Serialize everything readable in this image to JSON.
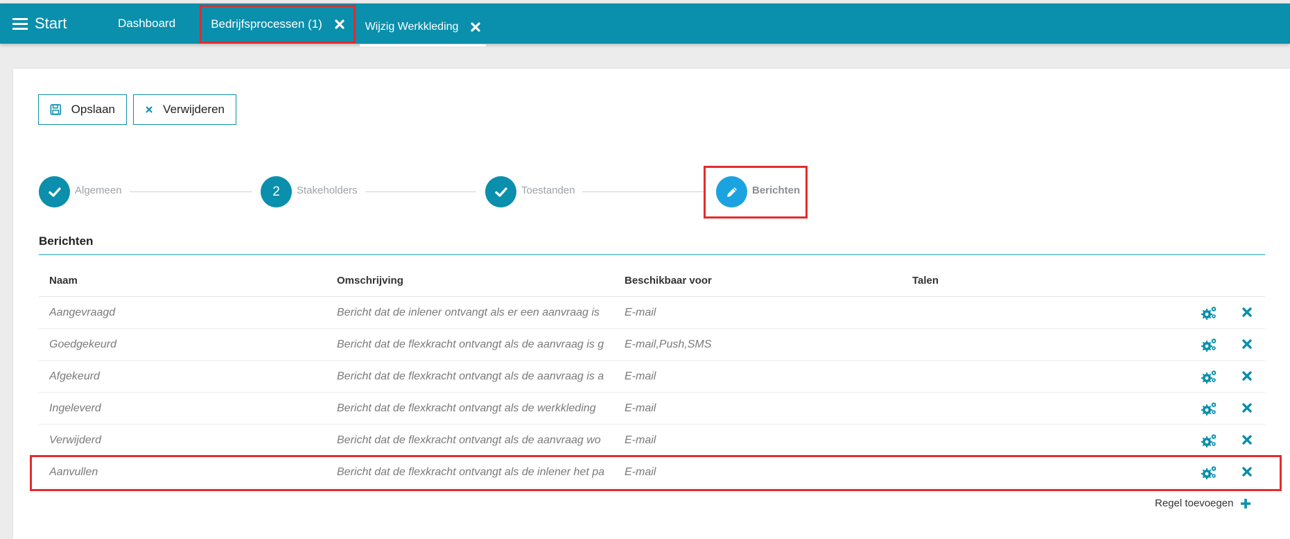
{
  "topbar": {
    "start_label": "Start",
    "tabs": [
      {
        "label": "Dashboard"
      },
      {
        "label": "Bedrijfsprocessen (1)"
      },
      {
        "label": "Wijzig Werkkleding"
      }
    ]
  },
  "toolbar": {
    "save_label": "Opslaan",
    "delete_label": "Verwijderen"
  },
  "steps": [
    {
      "label": "Algemeen",
      "state": "done"
    },
    {
      "label": "Stakeholders",
      "state": "numbered",
      "number": "2"
    },
    {
      "label": "Toestanden",
      "state": "done"
    },
    {
      "label": "Berichten",
      "state": "active"
    }
  ],
  "section": {
    "title": "Berichten"
  },
  "table": {
    "headers": [
      "Naam",
      "Omschrijving",
      "Beschikbaar voor",
      "Talen"
    ],
    "rows": [
      {
        "naam": "Aangevraagd",
        "omschrijving": "Bericht dat de inlener ontvangt als er een aanvraag is",
        "beschikbaar": "E-mail",
        "talen": ""
      },
      {
        "naam": "Goedgekeurd",
        "omschrijving": "Bericht dat de flexkracht ontvangt als de aanvraag is g",
        "beschikbaar": "E-mail,Push,SMS",
        "talen": ""
      },
      {
        "naam": "Afgekeurd",
        "omschrijving": "Bericht dat de flexkracht ontvangt als de aanvraag is a",
        "beschikbaar": "E-mail",
        "talen": ""
      },
      {
        "naam": "Ingeleverd",
        "omschrijving": "Bericht dat de flexkracht ontvangt als de werkkleding",
        "beschikbaar": "E-mail",
        "talen": ""
      },
      {
        "naam": "Verwijderd",
        "omschrijving": "Bericht dat de flexkracht ontvangt als de aanvraag wo",
        "beschikbaar": "E-mail",
        "talen": ""
      },
      {
        "naam": "Aanvullen",
        "omschrijving": "Bericht dat de flexkracht ontvangt als de inlener het pa",
        "beschikbaar": "E-mail",
        "talen": ""
      }
    ],
    "add_row_label": "Regel toevoegen"
  },
  "colors": {
    "primary": "#0a8fac",
    "active_step": "#1aa3e0",
    "highlight": "#e22c2c"
  }
}
